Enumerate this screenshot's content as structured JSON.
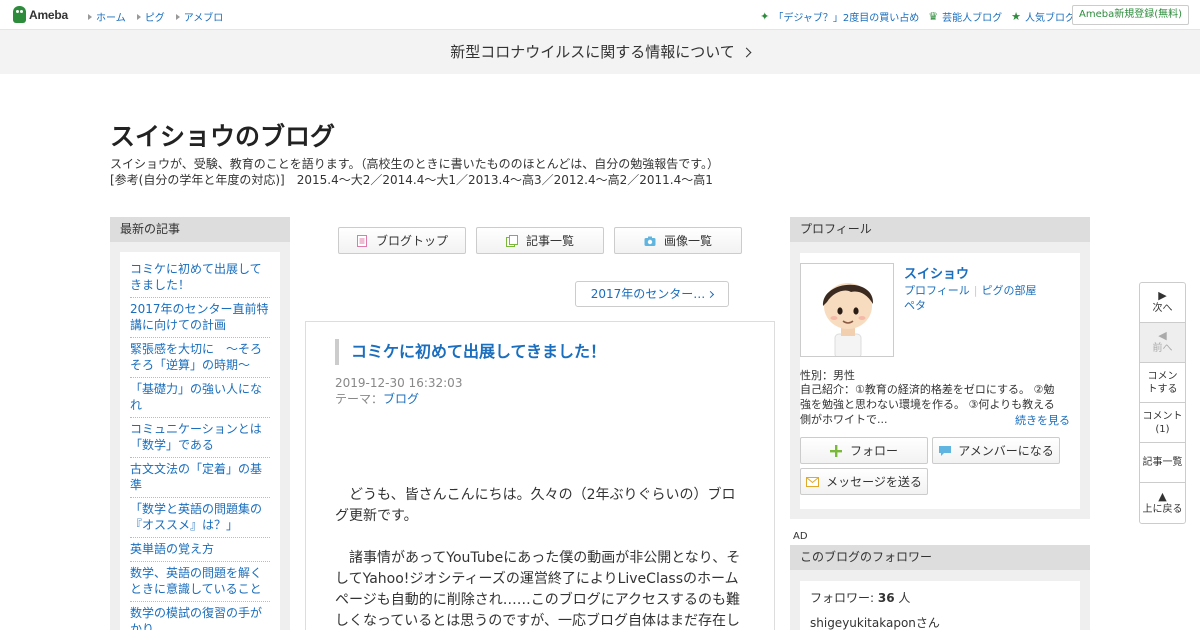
{
  "topbar": {
    "logo_text": "Ameba",
    "nav_left": [
      "ホーム",
      "ピグ",
      "アメブロ"
    ],
    "nav_right": [
      "「デジャブ？」2度目の買い占め",
      "芸能人ブログ",
      "人気ブログ"
    ],
    "register": "Ameba新規登録(無料)",
    "accent_color": "#2d8c3c"
  },
  "banner": {
    "text": "新型コロナウイルスに関する情報について"
  },
  "blog": {
    "title": "スイショウのブログ",
    "desc_line1": "スイショウが、受験、教育のことを語ります。（高校生のときに書いたもののほとんどは、自分の勉強報告です。）",
    "desc_line2": "[参考(自分の学年と年度の対応)]　2015.4～大2／2014.4～大1／2013.4～高3／2012.4～高2／2011.4～高1"
  },
  "recent": {
    "heading": "最新の記事",
    "items": [
      "コミケに初めて出展してきました！",
      "2017年のセンター直前特講に向けての計画",
      "緊張感を大切に　～そろそろ「逆算」の時期～",
      "「基礎力」の強い人になれ",
      "コミュニケーションとは「数学」である",
      "古文文法の「定着」の基準",
      "「数学と英語の問題集の『オススメ』は？」",
      "英単語の覚え方",
      "数学、英語の問題を解くときに意識していること",
      "数学の模試の復習の手がかり"
    ]
  },
  "tabs": [
    "ブログトップ",
    "記事一覧",
    "画像一覧"
  ],
  "pager": {
    "next_label": "2017年のセンター…"
  },
  "article": {
    "title": "コミケに初めて出展してきました！",
    "date": "2019-12-30 16:32:03",
    "theme_label": "テーマ：",
    "theme": "ブログ",
    "para1": "　どうも、皆さんこんにちは。久々の（2年ぶりぐらいの）ブログ更新です。",
    "para2": "　諸事情があってYouTubeにあった僕の動画が非公開となり、そしてYahoo!ジオシティーズの運営終了によりLiveClassのホームページも自動的に削除され……このブログにアクセスするのも難しくなっているとは思うのですが、一応ブログ自体はまだ存在し"
  },
  "profile": {
    "heading": "プロフィール",
    "name": "スイショウ",
    "link_profile": "プロフィール",
    "link_room": "ピグの部屋",
    "link_peta": "ペタ",
    "gender": "性別：男性",
    "intro": "自己紹介：①教育の経済的格差をゼロにする。 ②勉強を勉強と思わない環境を作る。 ③何よりも教える側がホワイトで...",
    "more": "続きを見る",
    "follow": "フォロー",
    "member": "アメンバーになる",
    "message": "メッセージを送る"
  },
  "ad_label": "AD",
  "followers": {
    "heading": "このブログのフォロワー",
    "count_label": "フォロワー: ",
    "count": "36",
    "count_unit": " 人",
    "first_follower": "shigeyukitakaponさん"
  },
  "sidenav": {
    "next": "次へ",
    "prev": "前へ",
    "comment_write": "コメントする",
    "comment_count": "コメント(1)",
    "article_list": "記事一覧",
    "back_top": "上に戻る"
  }
}
